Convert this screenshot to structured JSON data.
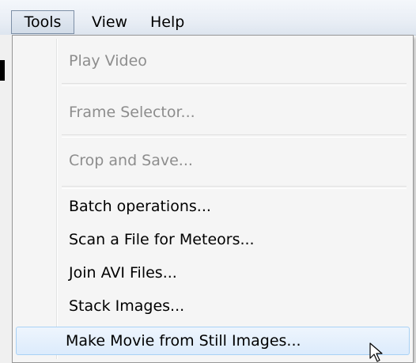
{
  "menubar": {
    "items": [
      {
        "label": "Tools",
        "active": true
      },
      {
        "label": "View",
        "active": false
      },
      {
        "label": "Help",
        "active": false
      }
    ]
  },
  "tools_menu": {
    "items": [
      {
        "label": "Play Video",
        "enabled": false
      },
      {
        "label": "Frame Selector...",
        "enabled": false
      },
      {
        "label": "Crop and Save...",
        "enabled": false
      },
      {
        "label": "Batch operations...",
        "enabled": true
      },
      {
        "label": "Scan a File for Meteors...",
        "enabled": true
      },
      {
        "label": "Join AVI Files...",
        "enabled": true
      },
      {
        "label": "Stack Images...",
        "enabled": true
      },
      {
        "label": "Make Movie from Still Images...",
        "enabled": true,
        "highlighted": true
      }
    ]
  },
  "colors": {
    "highlight_border": "#a8d1f5",
    "highlight_fill": "#dcebfc",
    "disabled_text": "#8d8d8d"
  },
  "icons": {
    "cursor": "mouse-pointer-icon"
  }
}
